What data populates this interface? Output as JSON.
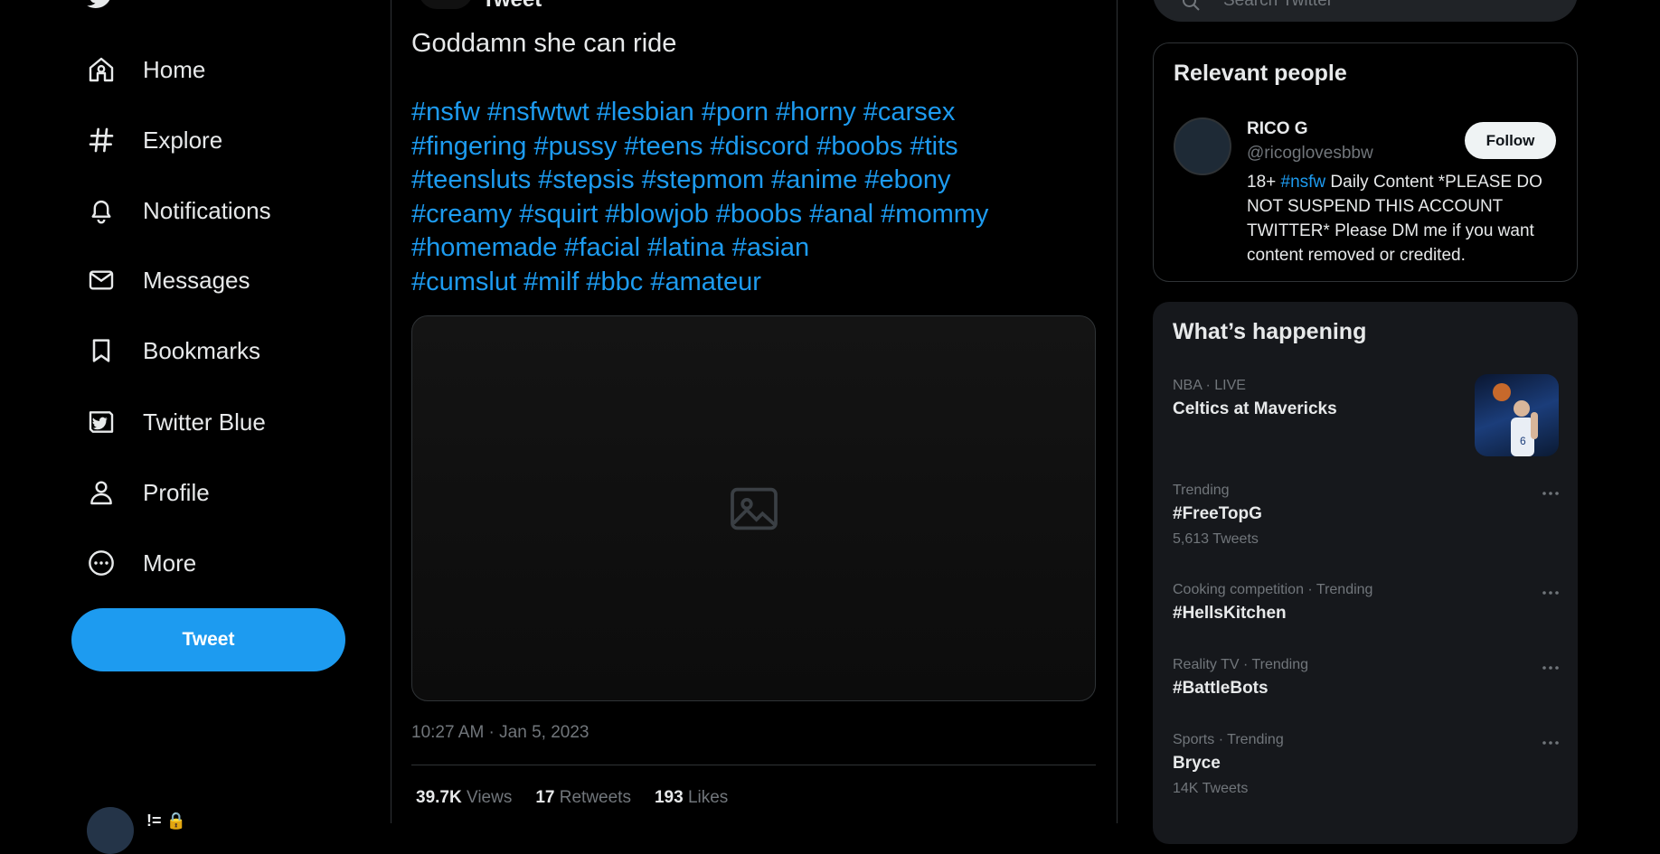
{
  "nav": {
    "items": [
      {
        "label": "Home",
        "icon": "home-icon"
      },
      {
        "label": "Explore",
        "icon": "hashtag-icon"
      },
      {
        "label": "Notifications",
        "icon": "bell-icon"
      },
      {
        "label": "Messages",
        "icon": "envelope-icon"
      },
      {
        "label": "Bookmarks",
        "icon": "bookmark-icon"
      },
      {
        "label": "Twitter Blue",
        "icon": "twitter-blue-icon"
      },
      {
        "label": "Profile",
        "icon": "person-icon"
      },
      {
        "label": "More",
        "icon": "more-circle-icon"
      }
    ],
    "tweet_button": "Tweet",
    "account_name": "!= 🔒"
  },
  "main": {
    "header_title": "Tweet",
    "tweet": {
      "text": "Goddamn she can ride",
      "hashtag_rows": [
        [
          "#nsfw",
          "#nsfwtwt",
          "#lesbian",
          "#porn",
          "#horny",
          "#carsex"
        ],
        [
          "#fingering",
          "#pussy",
          "#teens",
          "#discord",
          "#boobs",
          "#tits"
        ],
        [
          "#teensluts",
          "#stepsis",
          "#stepmom",
          "#anime",
          "#ebony"
        ],
        [
          "#creamy",
          "#squirt",
          "#blowjob",
          "#boobs",
          "#anal",
          "#mommy"
        ],
        [
          "#homemade",
          "#facial",
          "#latina",
          "#asian"
        ],
        [
          "#cumslut",
          "#milf",
          "#bbc",
          "#amateur"
        ]
      ],
      "timestamp": "10:27 AM · Jan 5, 2023",
      "stats": {
        "views_count": "39.7K",
        "views_label": "Views",
        "retweets_count": "17",
        "retweets_label": "Retweets",
        "likes_count": "193",
        "likes_label": "Likes"
      }
    }
  },
  "right": {
    "search_placeholder": "Search Twitter",
    "relevant_people": {
      "title": "Relevant people",
      "name": "RICO G",
      "handle": "@ricoglovesbbw",
      "follow_label": "Follow",
      "bio_prefix": "18+ ",
      "bio_link": "#nsfw",
      "bio_rest": " Daily Content *PLEASE DO NOT SUSPEND THIS ACCOUNT TWITTER* Please DM me if you want content removed or credited."
    },
    "whats_happening": {
      "title": "What’s happening",
      "trends": [
        {
          "meta": "NBA · LIVE",
          "title": "Celtics at Mavericks",
          "count": ""
        },
        {
          "meta": "Trending",
          "title": "#FreeTopG",
          "count": "5,613 Tweets"
        },
        {
          "meta": "Cooking competition · Trending",
          "title": "#HellsKitchen",
          "count": ""
        },
        {
          "meta": "Reality TV · Trending",
          "title": "#BattleBots",
          "count": ""
        },
        {
          "meta": "Sports · Trending",
          "title": "Bryce",
          "count": "14K Tweets"
        }
      ]
    }
  },
  "colors": {
    "accent": "#1d9bf0",
    "background": "#000000",
    "text": "#e7e9ea",
    "muted": "#71767b",
    "card": "#16181c"
  }
}
